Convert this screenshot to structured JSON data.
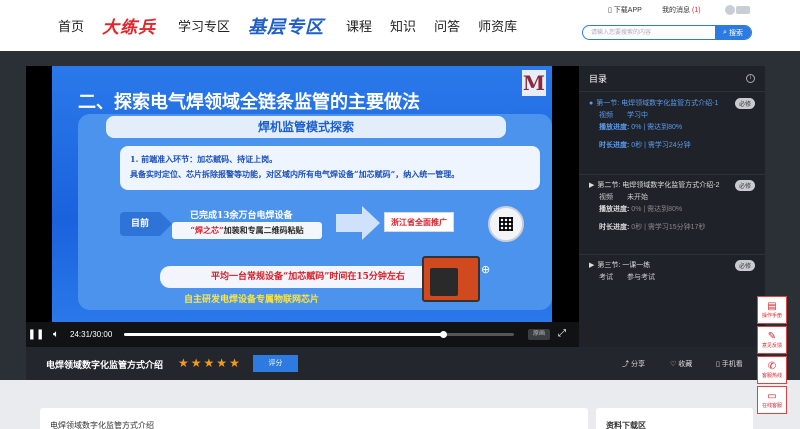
{
  "nav": {
    "items": [
      "首页",
      "大练兵",
      "学习专区",
      "基层专区",
      "课程",
      "知识",
      "问答",
      "师资库"
    ],
    "download_app": "下载APP",
    "messages": "我的消息",
    "message_count": "(1)",
    "search_placeholder": "请输入您要搜索的内容",
    "search_button": "搜索"
  },
  "slide": {
    "logo": "M",
    "title": "二、探索电气焊领域全链条监管的主要做法",
    "panel_title": "焊机监管模式探索",
    "step1_line1": "1. 前端准入环节：加芯赋码、持证上岗。",
    "step1_line2": "具备实时定位、芯片拆除报警等功能，对区域内所有电气焊设备“加芯赋码”，纳入统一管理。",
    "current_label": "目前",
    "completed_text": "已完成13余万台电焊设备",
    "chip_text_red": "“焊之芯”",
    "chip_text_rest": "加装和专属二维码粘贴",
    "promo": "浙江省全面推广",
    "average_time": "平均一台常规设备“加芯赋码”时间在15分钟左右",
    "self_developed": "自主研发电焊设备专属物联网芯片"
  },
  "player": {
    "current_time": "24:31",
    "total_time": "30:00",
    "time_display": "24:31/30:00",
    "progress": 0.817,
    "speed_label": "原画"
  },
  "sidebar": {
    "title": "目录",
    "sections": [
      {
        "title": "第一节: 电焊领域数字化监管方式介绍-1",
        "tag": "必修",
        "type_label": "视频",
        "status": "学习中",
        "play_progress_label": "播放进度:",
        "play_progress": "0% | 需达到80%",
        "duration_label": "时长进度:",
        "duration": "0秒 | 需学习24分钟"
      },
      {
        "title": "第二节: 电焊领域数字化监管方式介绍-2",
        "tag": "必修",
        "type_label": "视频",
        "status": "未开始",
        "play_progress_label": "播放进度:",
        "play_progress": "0% | 需达到80%",
        "duration_label": "时长进度:",
        "duration": "0秒 | 需学习15分钟17秒"
      },
      {
        "title": "第三节: 一课一练",
        "tag": "必修",
        "type_label": "考试",
        "status": "参与考试"
      }
    ]
  },
  "info": {
    "course_title": "电焊领域数字化监管方式介绍",
    "rating": 5,
    "rate_button": "评分",
    "share": "分享",
    "favorite": "收藏",
    "mobile": "手机看"
  },
  "bottom": {
    "card1": "电焊领域数字化监管方式介绍",
    "card2": "资料下载区"
  },
  "floats": [
    "操作手册",
    "意见反馈",
    "客服热线",
    "在线客服"
  ]
}
